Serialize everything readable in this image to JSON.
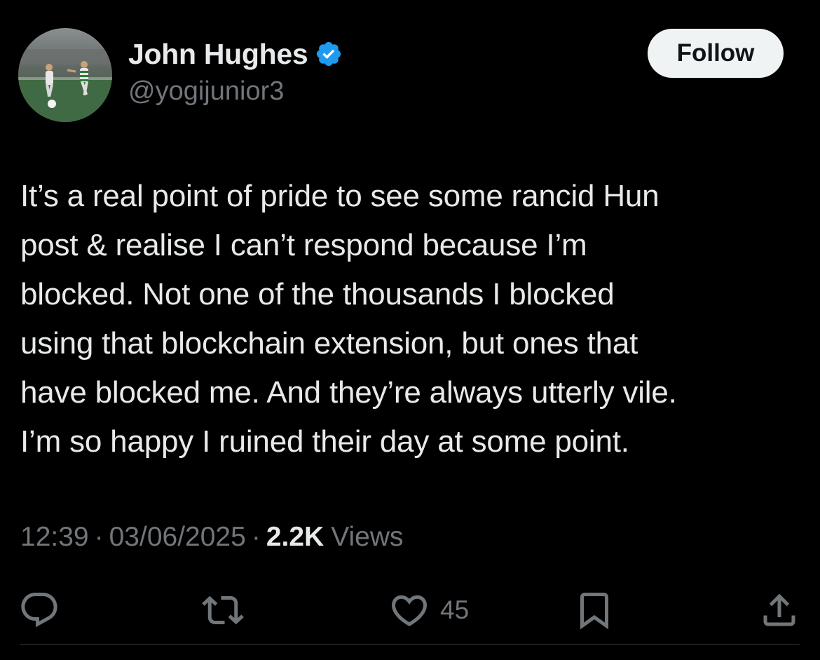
{
  "author": {
    "display_name": "John Hughes",
    "handle": "@yogijunior3",
    "verified": true,
    "verified_color": "#1d9bf0"
  },
  "follow_button": {
    "label": "Follow"
  },
  "tweet": {
    "lines": [
      "It’s a real point of pride to see some rancid Hun",
      "post & realise I can’t respond because I’m",
      "blocked. Not one of the thousands I blocked",
      "using that blockchain extension, but ones that",
      "have blocked me. And they’re always utterly vile.",
      "I’m so happy I ruined their day at some point."
    ]
  },
  "meta": {
    "time": "12:39",
    "separator": "·",
    "date": "03/06/2025",
    "views_count": "2.2K",
    "views_label": "Views"
  },
  "actions": {
    "reply_icon": "speech-bubble-icon",
    "repost_icon": "repost-arrows-icon",
    "like_icon": "heart-icon",
    "like_count": "45",
    "bookmark_icon": "bookmark-icon",
    "share_icon": "share-upload-icon"
  },
  "colors": {
    "background": "#000000",
    "primary_text": "#e7e9ea",
    "secondary_text": "#71767b",
    "follow_bg": "#eff3f4",
    "follow_text": "#0f1419",
    "divider": "#2f3336"
  }
}
